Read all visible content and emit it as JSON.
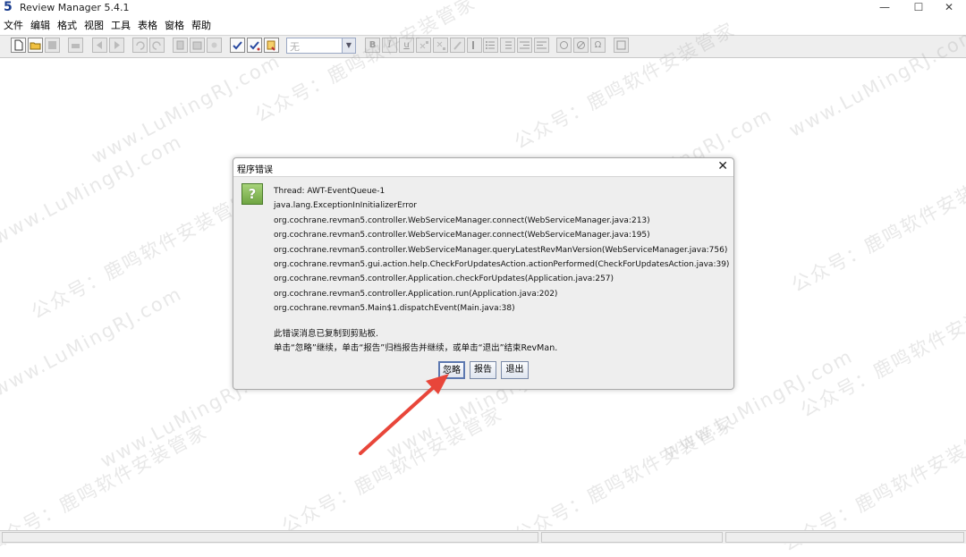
{
  "window": {
    "title": "Review Manager 5.4.1",
    "logo": "5",
    "minimize_glyph": "—",
    "maximize_glyph": "☐",
    "close_glyph": "✕"
  },
  "menubar": [
    "文件",
    "编辑",
    "格式",
    "视图",
    "工具",
    "表格",
    "窗格",
    "帮助"
  ],
  "toolbar": {
    "style_value": "无",
    "icons": [
      "new-document-icon",
      "open-folder-icon",
      "save-icon",
      "print-icon",
      "back-icon",
      "forward-icon",
      "undo-icon",
      "redo-icon",
      "copy-icon",
      "paste-icon",
      "cut-icon",
      "spellcheck-icon",
      "spellcheck-all-icon",
      "checklist-icon",
      "bold-icon",
      "italic-icon",
      "underline-icon",
      "superscript-icon",
      "subscript-icon",
      "highlight-icon",
      "clear-format-icon",
      "bullet-list-icon",
      "numbered-list-icon",
      "outdent-icon",
      "indent-icon",
      "link-icon",
      "unlink-icon",
      "symbol-icon",
      "panel-icon"
    ],
    "bold_glyph": "B",
    "italic_glyph": "I",
    "underline_glyph": "u",
    "omega_glyph": "Ω"
  },
  "dialog": {
    "title": "程序错误",
    "icon_glyph": "?",
    "close_glyph": "✕",
    "lines": [
      "Thread: AWT-EventQueue-1",
      "java.lang.ExceptionInInitializerError",
      "org.cochrane.revman5.controller.WebServiceManager.connect(WebServiceManager.java:213)",
      "org.cochrane.revman5.controller.WebServiceManager.connect(WebServiceManager.java:195)",
      "org.cochrane.revman5.controller.WebServiceManager.queryLatestRevManVersion(WebServiceManager.java:756)",
      "org.cochrane.revman5.gui.action.help.CheckForUpdatesAction.actionPerformed(CheckForUpdatesAction.java:39)",
      "org.cochrane.revman5.controller.Application.checkForUpdates(Application.java:257)",
      "org.cochrane.revman5.controller.Application.run(Application.java:202)",
      "org.cochrane.revman5.Main$1.dispatchEvent(Main.java:38)"
    ],
    "note_copied": "此错误消息已复制到剪贴板.",
    "note_instructions": "单击“忽略”继续，单击“报告”归档报告并继续，或单击“退出”结束RevMan.",
    "buttons": {
      "ignore": "忽略",
      "report": "报告",
      "exit": "退出"
    }
  },
  "watermark": {
    "url": "www.LuMingRJ.com",
    "account": "公众号：鹿鸣软件安装管家"
  },
  "colors": {
    "annotation_arrow": "#e8463a",
    "toolbar_bg": "#eeeeee"
  }
}
